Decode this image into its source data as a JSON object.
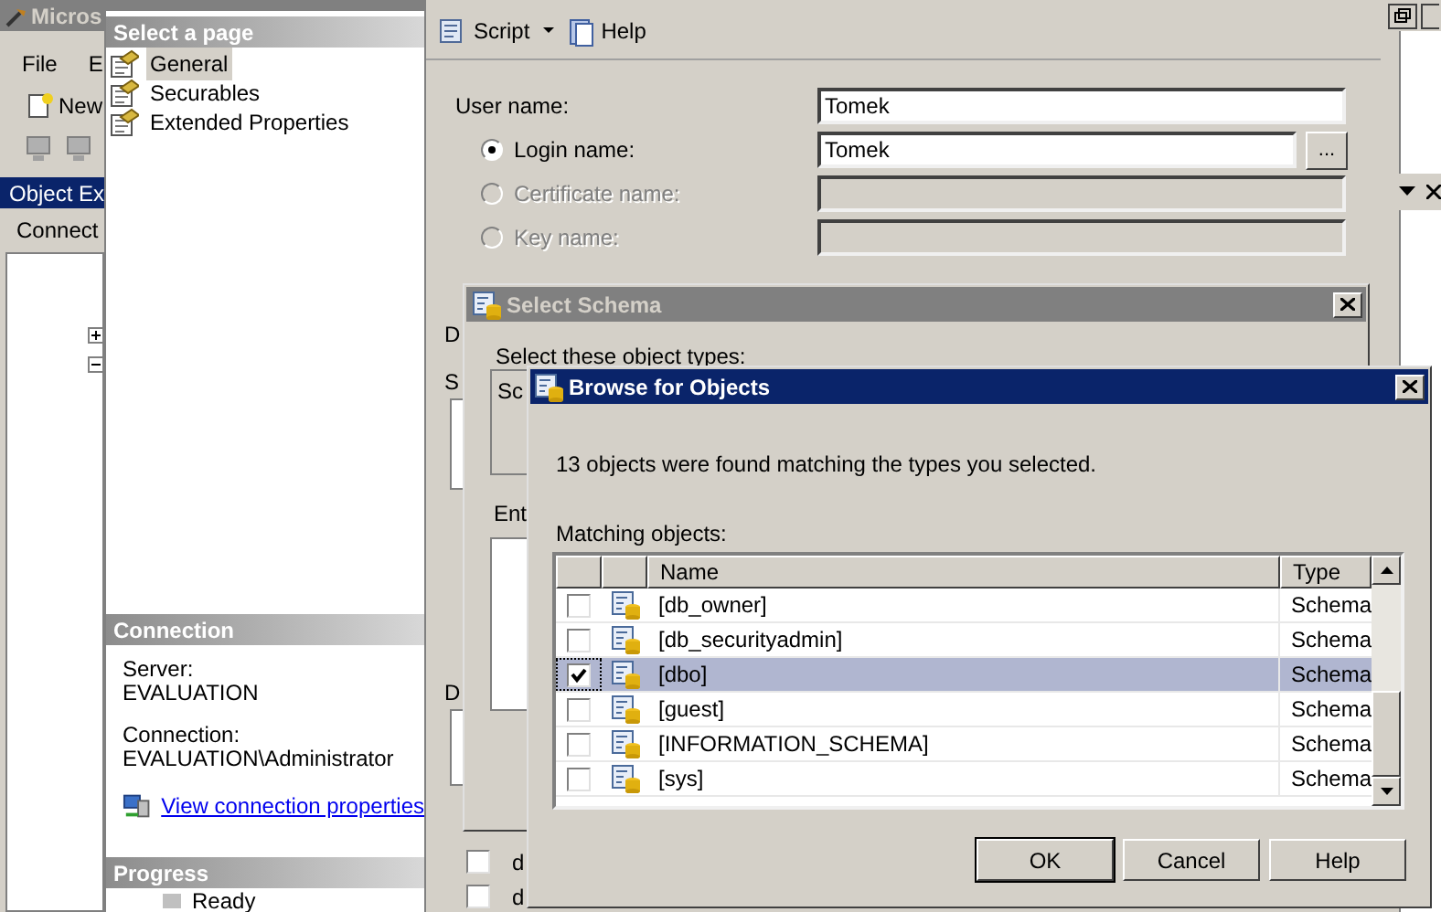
{
  "main_window": {
    "title": "Micros",
    "menu": [
      "File",
      "E"
    ],
    "toolbar": [
      "New"
    ],
    "object_explorer": {
      "title": "Object Ex",
      "connect": "Connect"
    }
  },
  "login_dialog": {
    "pages_header": "Select a page",
    "pages": [
      {
        "label": "General",
        "selected": true
      },
      {
        "label": "Securables",
        "selected": false
      },
      {
        "label": "Extended Properties",
        "selected": false
      }
    ],
    "toolbar": [
      "Script",
      "Help"
    ],
    "user_name": {
      "label": "User name:",
      "value": "Tomek"
    },
    "login_options": [
      {
        "label": "Login name:",
        "selected": true,
        "disabled": false,
        "value": "Tomek",
        "button": "..."
      },
      {
        "label": "Certificate name:",
        "selected": false,
        "disabled": true
      },
      {
        "label": "Key name:",
        "selected": false,
        "disabled": true
      }
    ],
    "cut_labels": [
      "D",
      "S",
      "D"
    ],
    "cut_list": [
      {
        "text": "d",
        "checked": false
      },
      {
        "text": "d",
        "checked": false
      }
    ],
    "connection": {
      "header": "Connection",
      "server_label": "Server:",
      "server": "EVALUATION",
      "connection_label": "Connection:",
      "connection": "EVALUATION\\Administrator",
      "link": "View connection properties"
    },
    "progress": {
      "header": "Progress",
      "status": "Ready"
    }
  },
  "select_schema": {
    "title": "Select Schema",
    "object_types_label": "Select these object types:",
    "object_types_value": "Sc",
    "enter_label": "Ent"
  },
  "browse_dialog": {
    "title": "Browse for Objects",
    "message": "13 objects were found matching the types you selected.",
    "list_label": "Matching objects:",
    "columns": [
      "Name",
      "Type"
    ],
    "rows": [
      {
        "name": "[db_owner]",
        "type": "Schema",
        "checked": false,
        "selected": false
      },
      {
        "name": "[db_securityadmin]",
        "type": "Schema",
        "checked": false,
        "selected": false
      },
      {
        "name": "[dbo]",
        "type": "Schema",
        "checked": true,
        "selected": true
      },
      {
        "name": "[guest]",
        "type": "Schema",
        "checked": false,
        "selected": false
      },
      {
        "name": "[INFORMATION_SCHEMA]",
        "type": "Schema",
        "checked": false,
        "selected": false
      },
      {
        "name": "[sys]",
        "type": "Schema",
        "checked": false,
        "selected": false
      }
    ],
    "buttons": [
      "OK",
      "Cancel",
      "Help"
    ]
  }
}
